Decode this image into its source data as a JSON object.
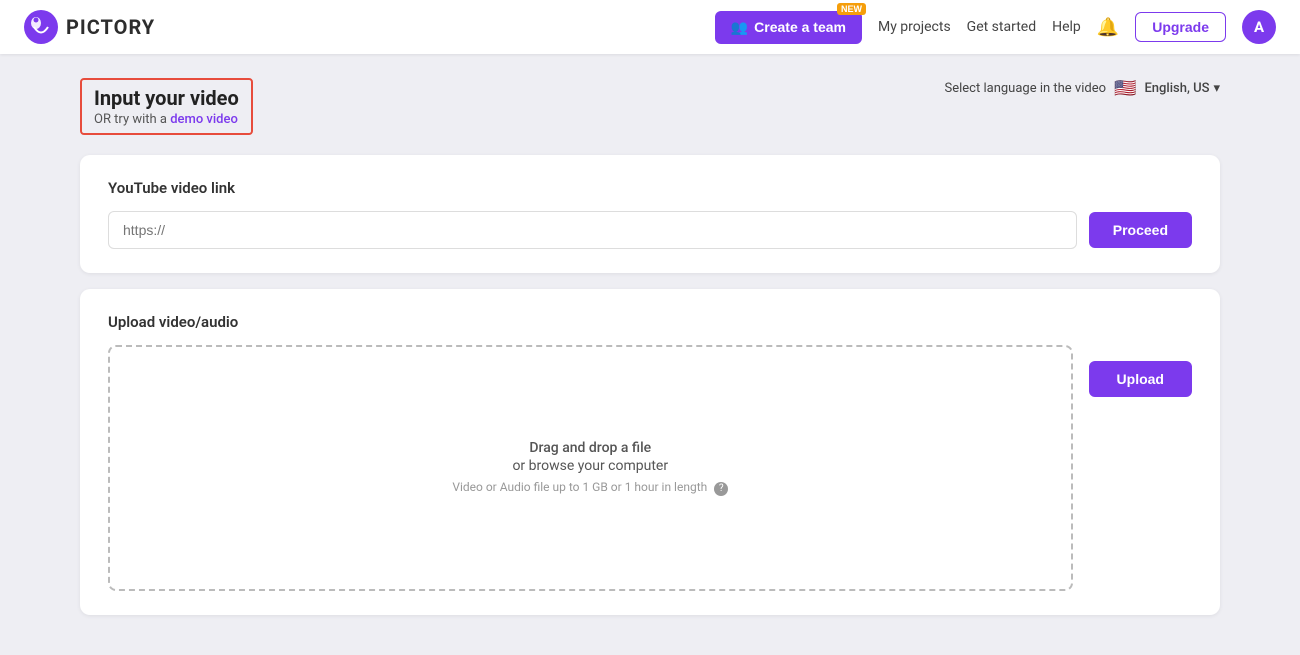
{
  "brand": {
    "name": "PICTORY",
    "logo_alt": "Pictory logo"
  },
  "navbar": {
    "create_team_label": "Create a team",
    "create_team_badge": "NEW",
    "my_projects": "My projects",
    "get_started": "Get started",
    "help": "Help",
    "upgrade_label": "Upgrade",
    "avatar_initial": "A"
  },
  "page": {
    "title": "Input your video",
    "subtitle_prefix": "OR try with a",
    "subtitle_link": "demo video",
    "language_label": "Select language in the video",
    "language_flag": "🇺🇸",
    "language_value": "English, US",
    "chevron": "▾"
  },
  "youtube_section": {
    "title": "YouTube video link",
    "input_placeholder": "https://",
    "proceed_label": "Proceed"
  },
  "upload_section": {
    "title": "Upload video/audio",
    "drag_drop_line1": "Drag and drop a file",
    "drag_drop_line2": "or browse your computer",
    "limit_text": "Video or Audio file up to 1 GB or 1 hour in length",
    "upload_label": "Upload",
    "help_icon": "?"
  }
}
